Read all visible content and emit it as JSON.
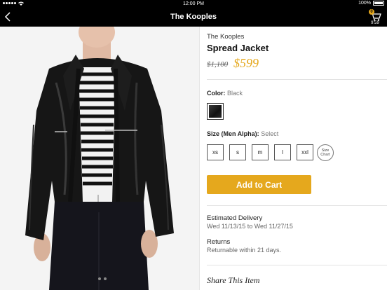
{
  "status_bar": {
    "time": "12:00 PM",
    "battery": "100%"
  },
  "nav": {
    "title": "The Kooples",
    "cart_count": "0",
    "cart_timer": "9:59"
  },
  "product": {
    "brand": "The Kooples",
    "name": "Spread Jacket",
    "original_price": "$1,100",
    "sale_price": "$599"
  },
  "color": {
    "label": "Color:",
    "value": "Black"
  },
  "size": {
    "label": "Size (Men Alpha):",
    "value": "Select",
    "options": [
      "xs",
      "s",
      "m",
      "l",
      "xxl"
    ],
    "chart_label": "Size Chart"
  },
  "add_to_cart_label": "Add to Cart",
  "delivery": {
    "title": "Estimated Delivery",
    "value": "Wed 11/13/15 to Wed 11/27/15"
  },
  "returns": {
    "title": "Returns",
    "value": "Returnable within 21 days."
  },
  "share_title": "Share This Item",
  "colors": {
    "accent": "#e5a81d",
    "bar": "#000000"
  },
  "icons": [
    "back-chevron-icon",
    "cart-icon",
    "wifi-icon",
    "battery-icon",
    "signal-icon"
  ]
}
